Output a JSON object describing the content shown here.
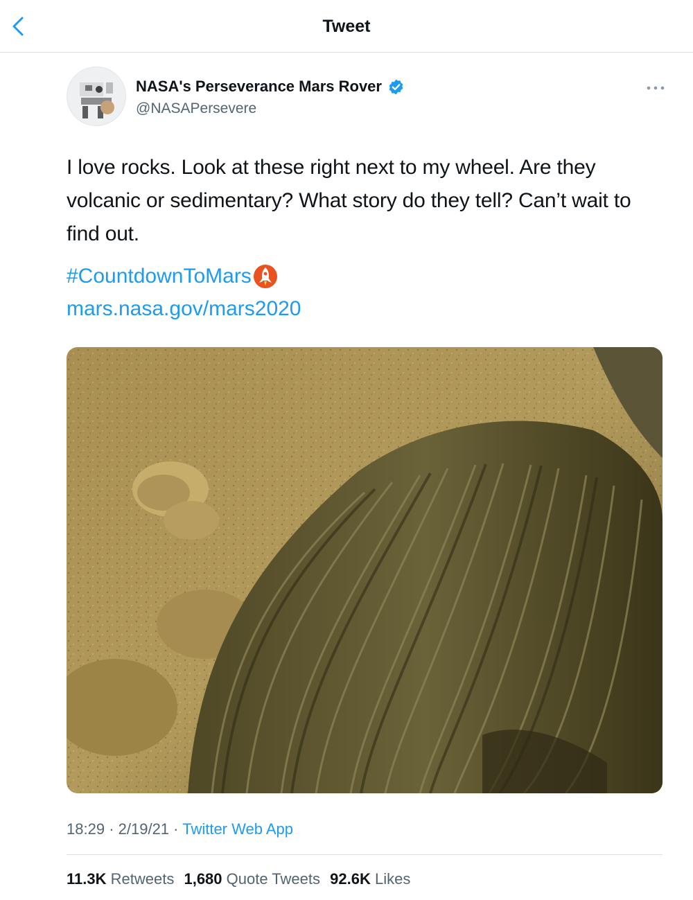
{
  "header": {
    "title": "Tweet",
    "back_icon": "chevron-left-icon"
  },
  "tweet": {
    "author": {
      "name": "NASA's Perseverance Mars Rover",
      "handle": "@NASAPersevere",
      "verified": true,
      "avatar_icon": "rover-avatar"
    },
    "text": "I love rocks. Look at these right next to my wheel. Are they volcanic or sedimentary? What story do they tell? Can’t wait to find out.",
    "hashtag": "#CountdownToMars",
    "hashtag_emoji": "rocket-icon",
    "link": "mars.nasa.gov/mars2020",
    "media_icon": "mars-rover-wheel-photo",
    "time": "18:29",
    "separator": "·",
    "date": "2/19/21",
    "source": "Twitter Web App",
    "stats": [
      {
        "count": "11.3K",
        "label": "Retweets"
      },
      {
        "count": "1,680",
        "label": "Quote Tweets"
      },
      {
        "count": "92.6K",
        "label": "Likes"
      }
    ]
  },
  "colors": {
    "link": "#1d9bf0",
    "muted": "#536471",
    "text": "#0f1419",
    "verified": "#1d9bf0"
  }
}
